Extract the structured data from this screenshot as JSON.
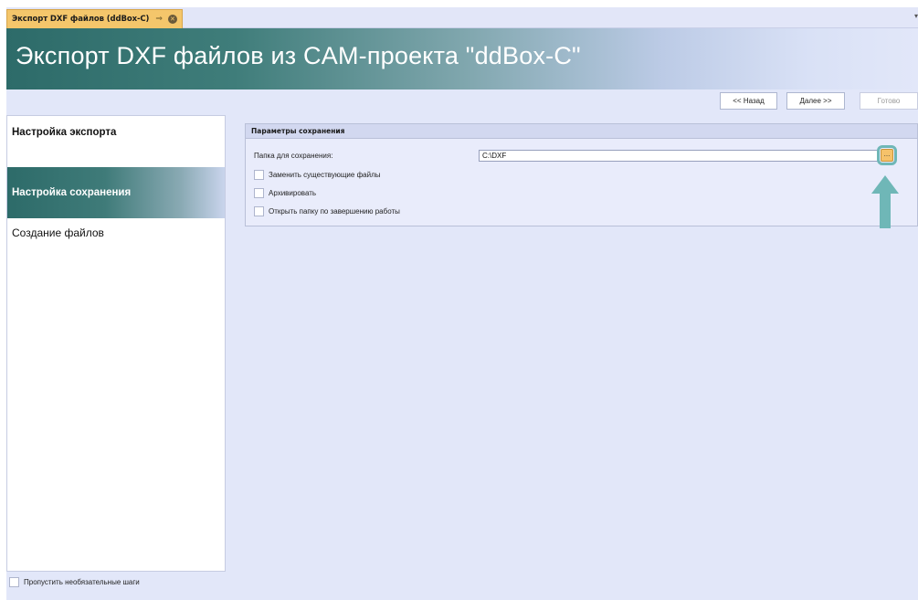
{
  "tab": {
    "title": "Экспорт DXF файлов (ddBox-C)",
    "pin_glyph": "⇒",
    "close_glyph": "✕",
    "dropdown_glyph": "▾"
  },
  "header": {
    "title": "Экспорт DXF файлов из CAM-проекта \"ddBox-C\""
  },
  "nav": {
    "back_label": "<< Назад",
    "next_label": "Далее >>",
    "finish_label": "Готово"
  },
  "steps": [
    {
      "label": "Настройка экспорта"
    },
    {
      "label": "Настройка сохранения"
    },
    {
      "label": "Создание файлов"
    }
  ],
  "skip_optional_label": "Пропустить необязательные шаги",
  "save_params": {
    "header": "Параметры сохранения",
    "folder_label": "Папка для сохранения:",
    "folder_value": "C:\\DXF",
    "browse_label": "...",
    "replace_existing_label": "Заменить существующие файлы",
    "archive_label": "Архивировать",
    "open_folder_label": "Открыть папку по завершению работы"
  },
  "colors": {
    "accent_teal": "#2d6b69",
    "highlight": "#6fb7b7",
    "tab_active": "#f4c66b"
  }
}
